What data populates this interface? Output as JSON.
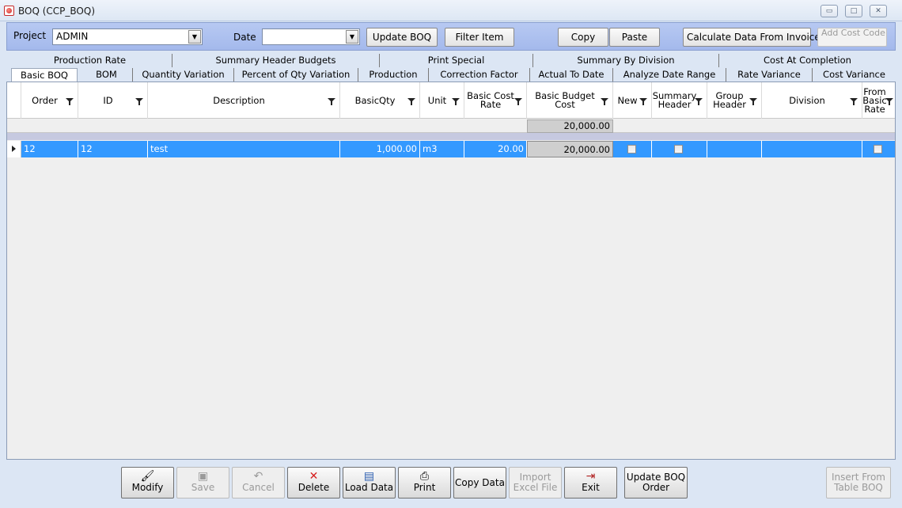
{
  "window": {
    "title": "BOQ  (CCP_BOQ)",
    "icons": {
      "app": "app-icon",
      "minimize": "minimize-icon",
      "maximize": "maximize-icon",
      "close": "close-icon"
    },
    "buttons": {
      "minimize": "▭",
      "maximize": "□",
      "close": "✕"
    }
  },
  "toolbar": {
    "project_label": "Project",
    "project_value": "ADMIN",
    "date_label": "Date",
    "date_value": "",
    "update_boq": "Update BOQ",
    "filter_item": "Filter Item",
    "copy": "Copy",
    "paste": "Paste",
    "calculate": "Calculate Data From Invoice",
    "add_cost_code": "Add Cost Code",
    "dropdown_glyph": "▼"
  },
  "tabs_row1": [
    "Production Rate",
    "Summary Header Budgets",
    "Print Special",
    "Summary By Division",
    "Cost At Completion"
  ],
  "tabs_row2": [
    "Basic BOQ",
    "BOM",
    "Quantity Variation",
    "Percent of Qty Variation",
    "Production",
    "Correction Factor",
    "Actual To Date",
    "Analyze Date Range",
    "Rate Variance",
    "Cost Variance"
  ],
  "active_tab": "Basic BOQ",
  "grid": {
    "columns": [
      "Order",
      "ID",
      "Description",
      "BasicQty",
      "Unit",
      "Basic Cost Rate",
      "Basic Budget Cost",
      "New",
      "Summary Header",
      "Group Header",
      "Division",
      "From Basic Rate"
    ],
    "summary": {
      "basic_budget_cost_total": "20,000.00"
    },
    "rows": [
      {
        "order": "12",
        "id": "12",
        "description": "test",
        "basic_qty": "1,000.00",
        "unit": "m3",
        "basic_cost_rate": "20.00",
        "basic_budget_cost": "20,000.00",
        "new": false,
        "summary_header": false,
        "group_header": "",
        "division": "",
        "from_basic_rate": false
      }
    ]
  },
  "bottom_buttons": {
    "modify": "Modify",
    "save": "Save",
    "cancel": "Cancel",
    "delete": "Delete",
    "load_data": "Load Data",
    "print": "Print",
    "copy_data": "Copy Data",
    "import_excel": "Import Excel File",
    "exit": "Exit",
    "update_boq_order": "Update BOQ Order",
    "insert_from_table": "Insert From Table BOQ"
  },
  "colors": {
    "selection": "#3399ff",
    "toolbar": "#aabff0",
    "background": "#dce6f4"
  }
}
